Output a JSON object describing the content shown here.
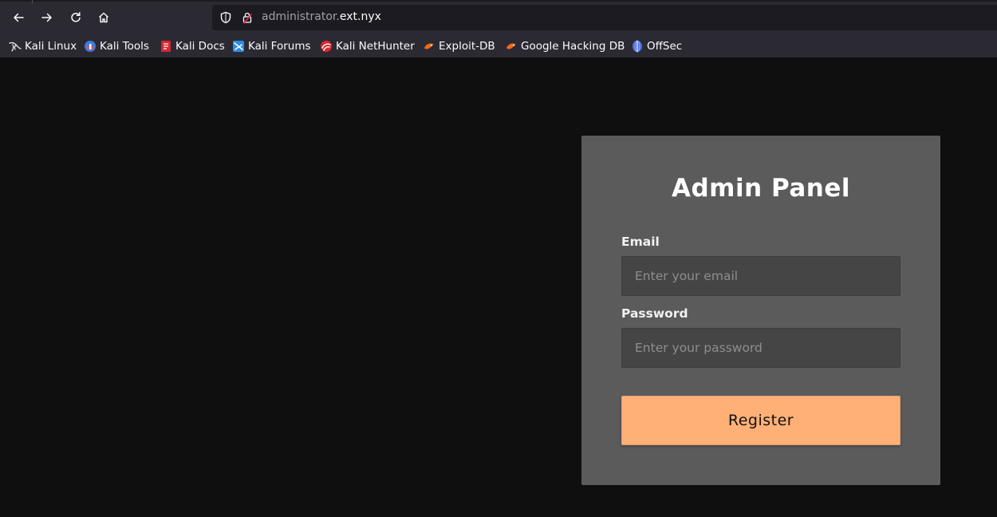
{
  "browser": {
    "url": {
      "host_sub": "administrator.",
      "host_domain": "ext.nyx"
    },
    "nav": {
      "back_icon": "arrow-left-icon",
      "forward_icon": "arrow-right-icon",
      "reload_icon": "reload-icon",
      "home_icon": "home-icon"
    },
    "bookmarks": [
      {
        "label": "Kali Linux",
        "icon": "kali-dragon-icon"
      },
      {
        "label": "Kali Tools",
        "icon": "kali-tools-icon"
      },
      {
        "label": "Kali Docs",
        "icon": "kali-docs-icon"
      },
      {
        "label": "Kali Forums",
        "icon": "kali-forums-icon"
      },
      {
        "label": "Kali NetHunter",
        "icon": "kali-nethunter-icon"
      },
      {
        "label": "Exploit-DB",
        "icon": "exploit-db-icon"
      },
      {
        "label": "Google Hacking DB",
        "icon": "ghdb-icon"
      },
      {
        "label": "OffSec",
        "icon": "offsec-icon"
      }
    ]
  },
  "panel": {
    "title": "Admin Panel",
    "email": {
      "label": "Email",
      "placeholder": "Enter your email",
      "value": ""
    },
    "password": {
      "label": "Password",
      "placeholder": "Enter your password",
      "value": ""
    },
    "submit_label": "Register"
  },
  "colors": {
    "page_bg": "#0f0f0f",
    "panel_bg": "#5b5b5b",
    "input_bg": "#454545",
    "button_bg": "#ffb077",
    "chrome_bg": "#2b2a33"
  }
}
